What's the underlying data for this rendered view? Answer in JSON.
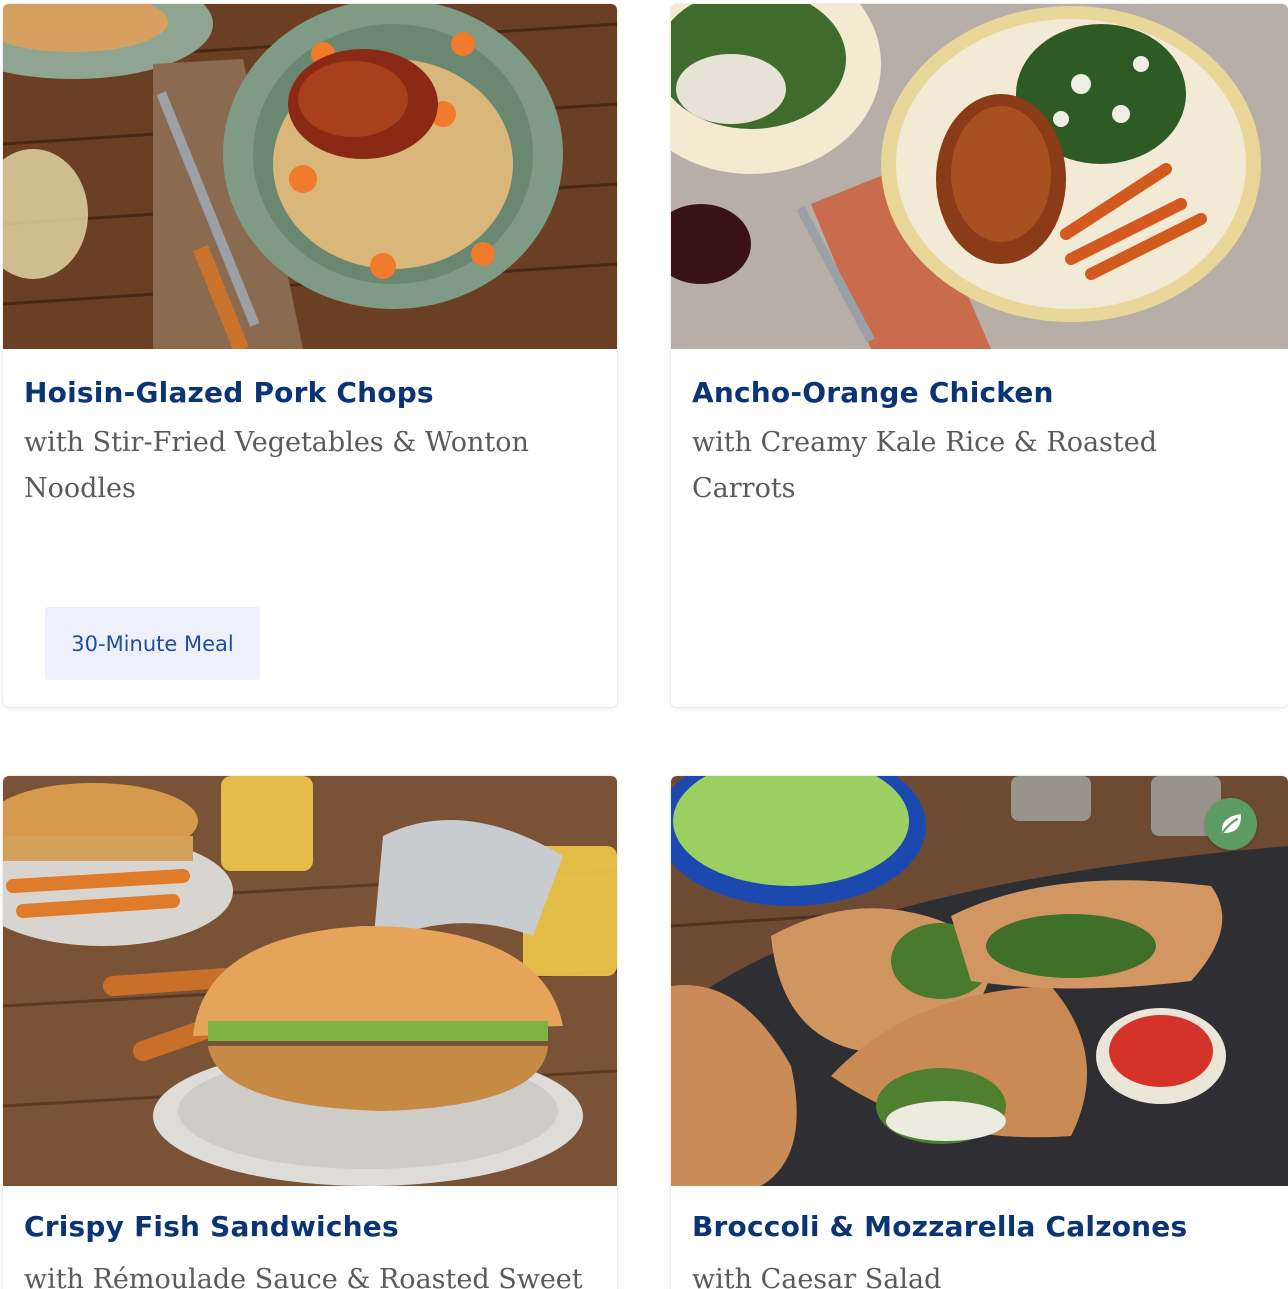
{
  "theme": {
    "title_color": "#0b3475",
    "subtitle_color": "#5a5a5a",
    "tag_bg": "#eef1fb",
    "tag_color": "#1f4ea0",
    "veg_badge_color": "#5c9c62"
  },
  "recipes": [
    {
      "title": "Hoisin-Glazed Pork Chops",
      "subtitle": "with Stir-Fried Vegetables & Wonton Noodles",
      "tag": "30-Minute Meal",
      "image_icon": "pork-chops-photo"
    },
    {
      "title": "Ancho-Orange Chicken",
      "subtitle": "with Creamy Kale Rice & Roasted Carrots",
      "image_icon": "chicken-photo"
    },
    {
      "title": "Crispy Fish Sandwiches",
      "subtitle": "with Rémoulade Sauce & Roasted Sweet",
      "image_icon": "fish-sandwich-photo"
    },
    {
      "title": "Broccoli & Mozzarella Calzones",
      "subtitle": "with Caesar Salad",
      "badge_icon": "vegetarian-leaf-icon",
      "image_icon": "calzones-photo"
    }
  ]
}
